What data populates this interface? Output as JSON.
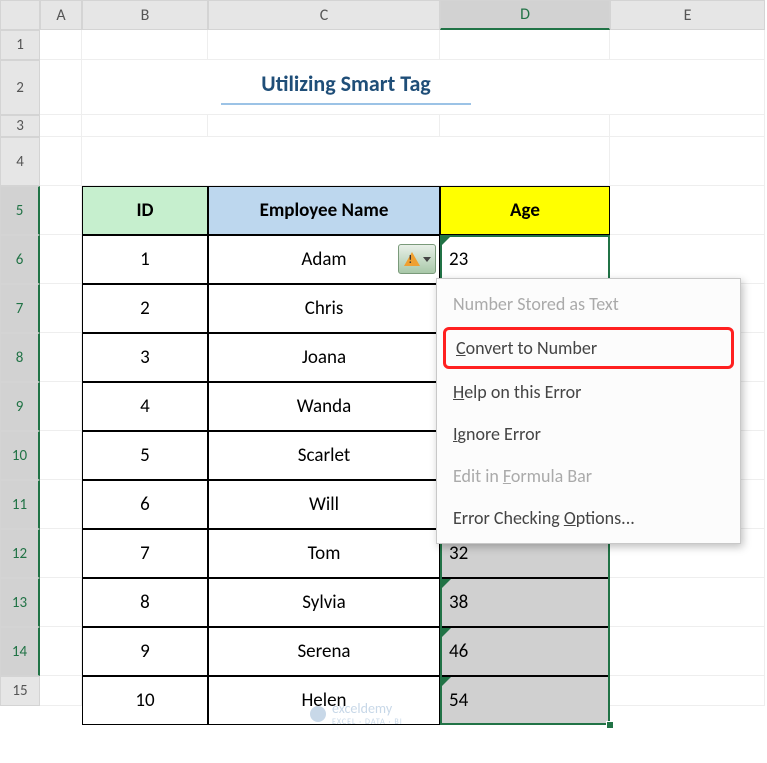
{
  "columns": [
    "A",
    "B",
    "C",
    "D",
    "E"
  ],
  "rows": [
    "1",
    "2",
    "3",
    "4",
    "5",
    "6",
    "7",
    "8",
    "9",
    "10",
    "11",
    "12",
    "13",
    "14",
    "15"
  ],
  "title": "Utilizing Smart Tag",
  "table": {
    "headers": {
      "id": "ID",
      "name": "Employee Name",
      "age": "Age"
    },
    "data": [
      {
        "id": "1",
        "name": "Adam",
        "age": "23"
      },
      {
        "id": "2",
        "name": "Chris",
        "age": ""
      },
      {
        "id": "3",
        "name": "Joana",
        "age": ""
      },
      {
        "id": "4",
        "name": "Wanda",
        "age": ""
      },
      {
        "id": "5",
        "name": "Scarlet",
        "age": ""
      },
      {
        "id": "6",
        "name": "Will",
        "age": ""
      },
      {
        "id": "7",
        "name": "Tom",
        "age": "32"
      },
      {
        "id": "8",
        "name": "Sylvia",
        "age": "38"
      },
      {
        "id": "9",
        "name": "Serena",
        "age": "46"
      },
      {
        "id": "10",
        "name": "Helen",
        "age": "54"
      }
    ]
  },
  "menu": {
    "header": "Number Stored as Text",
    "convert": "Convert to Number",
    "help": "Help on this Error",
    "ignore": "Ignore Error",
    "editbar": "Edit in Formula Bar",
    "options": "Error Checking Options..."
  },
  "watermark": {
    "brand": "exceldemy",
    "sub": "EXCEL · DATA · BI"
  }
}
